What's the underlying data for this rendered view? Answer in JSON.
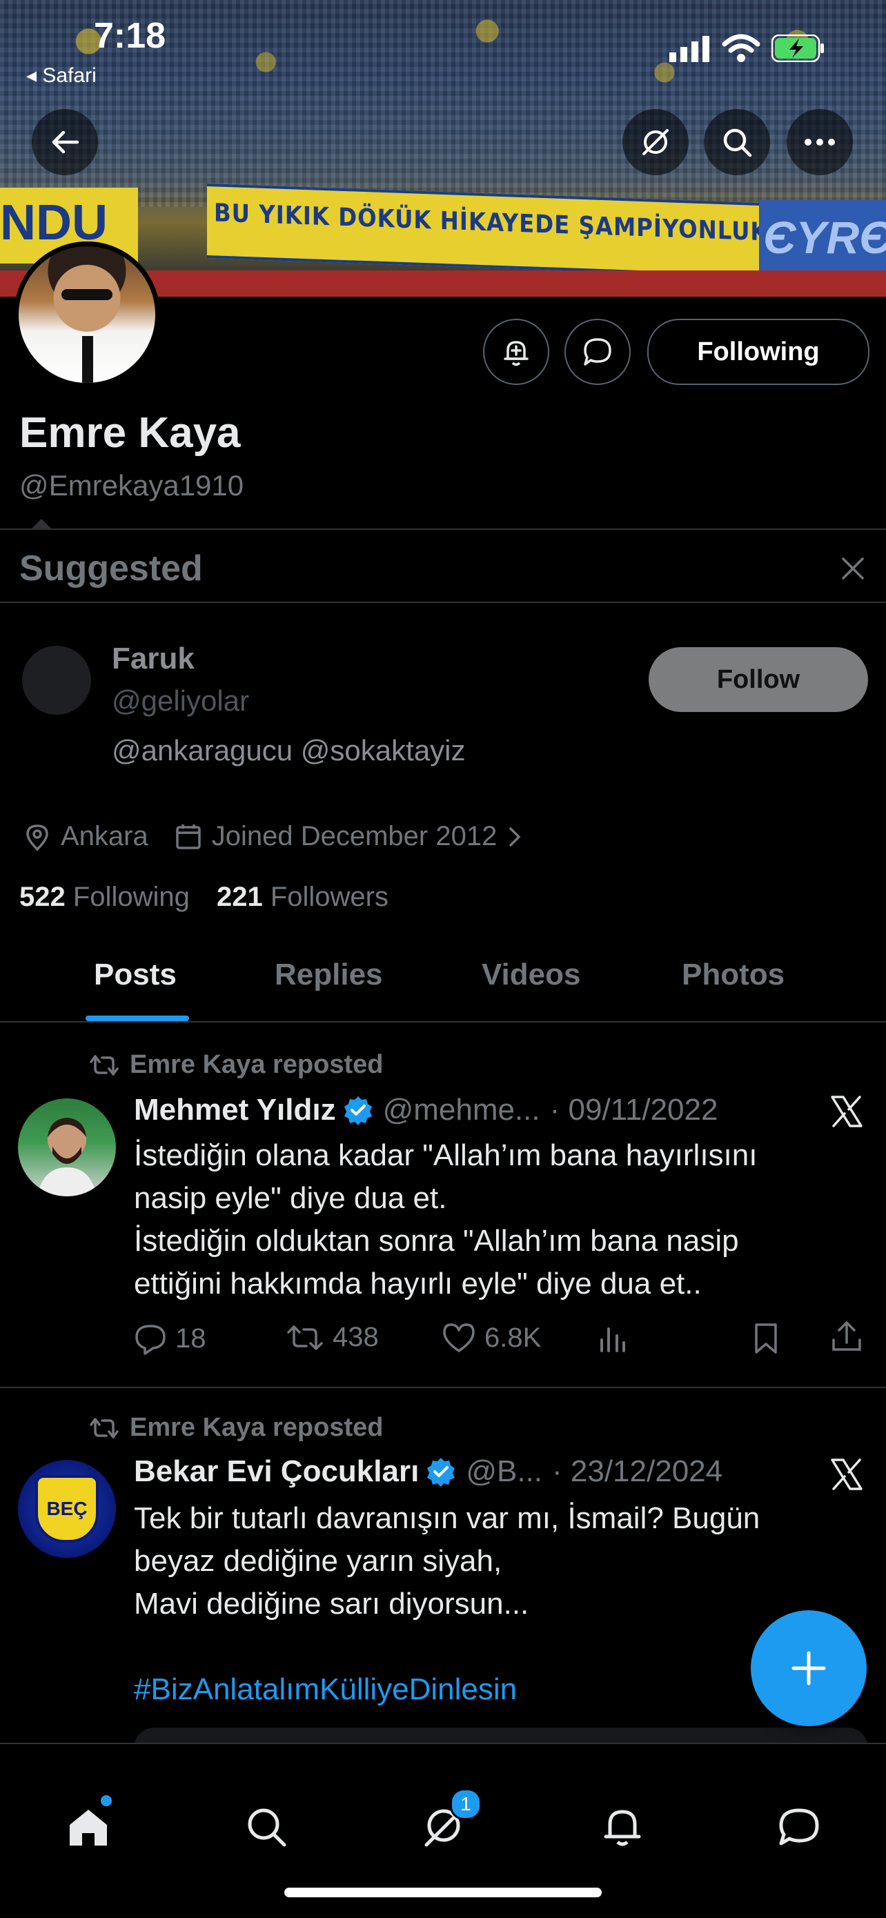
{
  "status_bar": {
    "time": "7:18",
    "back_app": "◂ Safari"
  },
  "banner": {
    "sign_text": "BU YIKIK DÖKÜK HİKAYEDE ŞAMPİYONLUK EKSİK ÇOCUKLAR",
    "left_sign": "NDU",
    "right_sign": "ЄYRЄS"
  },
  "profile": {
    "display_name": "Emre Kaya",
    "handle": "@Emrekaya1910",
    "following_button": "Following",
    "location": "Ankara",
    "joined": "Joined December 2012",
    "following_count": "522",
    "following_label": "Following",
    "followers_count": "221",
    "followers_label": "Followers"
  },
  "suggested": {
    "title": "Suggested",
    "name": "Faruk",
    "handle": "@geliyolar",
    "bio": "@ankaragucu @sokaktayiz",
    "follow_label": "Follow"
  },
  "tabs": [
    "Posts",
    "Replies",
    "Videos",
    "Photos"
  ],
  "posts": [
    {
      "repost_label": "Emre Kaya reposted",
      "author": "Mehmet Yıldız",
      "handle": "@mehme...",
      "date": "· 09/11/2022",
      "lines": [
        "İstediğin olana kadar \"Allah’ım bana hayırlısını",
        "nasip eyle\" diye dua et.",
        "İstediğin olduktan sonra \"Allah’ım bana nasip",
        "ettiğini hakkımda hayırlı eyle\" diye dua et.."
      ],
      "replies": "18",
      "reposts": "438",
      "likes": "6.8K"
    },
    {
      "repost_label": "Emre Kaya reposted",
      "author": "Bekar Evi Çocukları",
      "handle": "@B...",
      "date": "· 23/12/2024",
      "lines": [
        "Tek bir tutarlı davranışın var mı, İsmail? Bugün",
        "beyaz dediğine yarın siyah,",
        "Mavi dediğine sarı diyorsun..."
      ],
      "hashtag": "#BizAnlatalımKülliyeDinlesin",
      "avatar_text": "BEÇ"
    }
  ],
  "nav": {
    "messages_badge": "1"
  },
  "colors": {
    "accent": "#1d9bf0",
    "muted": "#71767b",
    "background": "#000000"
  }
}
